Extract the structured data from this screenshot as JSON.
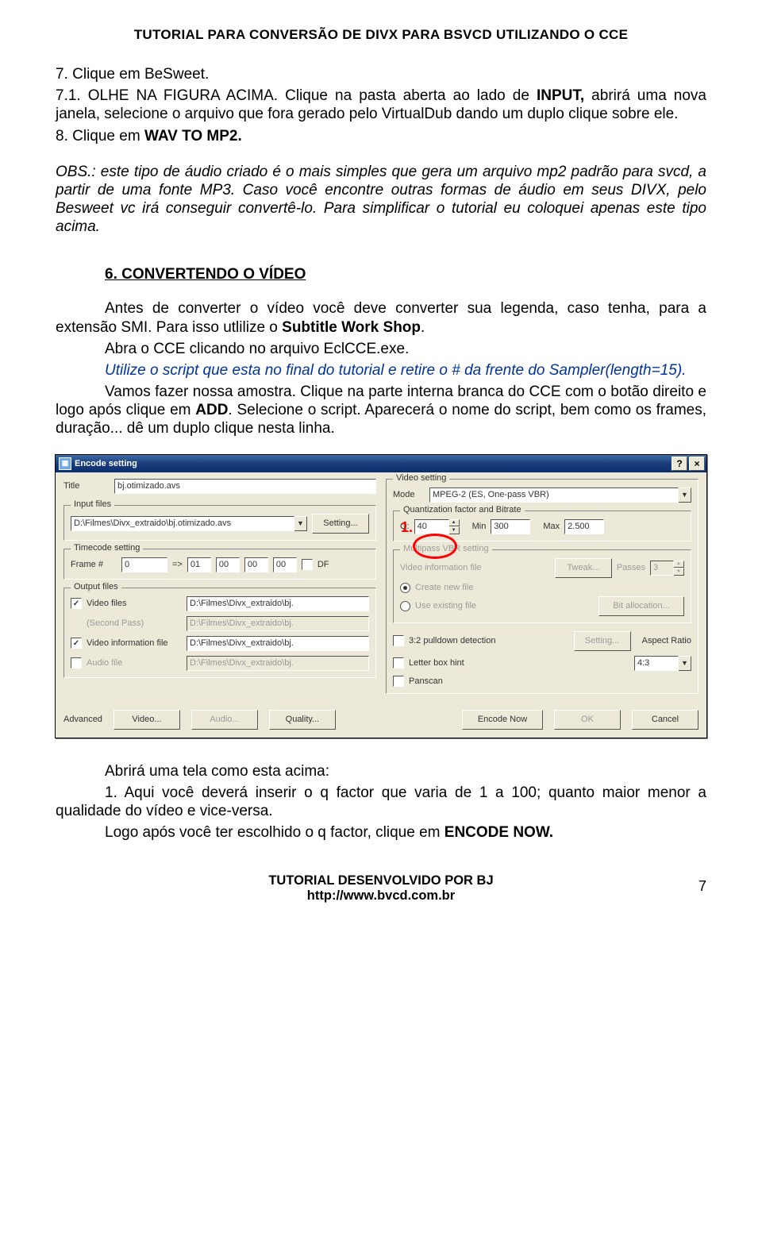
{
  "header": "TUTORIAL PARA CONVERSÃO DE DIVX PARA BSVCD UTILIZANDO O CCE",
  "p7": "7. Clique em BeSweet.",
  "p71a": "7.1. OLHE NA FIGURA ACIMA. Clique na pasta aberta ao lado de ",
  "p71b": "INPUT,",
  "p71c": " abrirá uma nova janela, selecione o arquivo que fora gerado pelo VirtualDub dando um duplo clique sobre ele.",
  "p8a": "8. Clique em ",
  "p8b": "WAV TO MP2.",
  "obs": "OBS.: este tipo de áudio criado é o mais simples que gera um arquivo mp2 padrão para svcd, a partir de uma fonte MP3. Caso você encontre outras formas de áudio em seus DIVX, pelo Besweet vc irá conseguir convertê-lo. Para simplificar o tutorial eu coloquei apenas este tipo acima.",
  "section6": "6. CONVERTENDO O VÍDEO",
  "s6_p1a": "Antes de converter o vídeo você deve converter sua legenda, caso tenha, para a extensão SMI. Para isso utlilize o ",
  "s6_p1b": "Subtitle Work Shop",
  "s6_p1c": ".",
  "s6_p2": "Abra o CCE clicando no arquivo EclCCE.exe.",
  "s6_p3": "Utilize o script que esta no final do tutorial e retire o # da frente do Sampler(length=15).",
  "s6_p4a": "Vamos fazer nossa amostra. Clique na parte interna branca do CCE com o botão direito e logo após clique em ",
  "s6_p4b": "ADD",
  "s6_p4c": ". Selecione o script. Aparecerá o nome do script, bem como os frames, duração... dê um duplo clique nesta linha.",
  "dialog": {
    "title": "Encode setting",
    "help": "?",
    "close": "×",
    "left": {
      "titleLabel": "Title",
      "titleValue": "bj.otimizado.avs",
      "inputGroup": "Input files",
      "inputFile": "D:\\Filmes\\Divx_extraido\\bj.otimizado.avs",
      "settingBtn": "Setting...",
      "timecodeGroup": "Timecode setting",
      "frameLabel": "Frame #",
      "frameValue": "0",
      "arrow": "=>",
      "tc1": "01",
      "tc2": "00",
      "tc3": "00",
      "tc4": "00",
      "dfLabel": "DF",
      "outputGroup": "Output files",
      "videoFiles": "Video files",
      "secondPass": "(Second Pass)",
      "videoInfoFile": "Video information file",
      "audioFile": "Audio file",
      "path1": "D:\\Filmes\\Divx_extraido\\bj.",
      "path2": "D:\\Filmes\\Divx_extraido\\bj.",
      "path3": "D:\\Filmes\\Divx_extraido\\bj.",
      "path4": "D:\\Filmes\\Divx_extraido\\bj."
    },
    "right": {
      "videoSetting": "Video setting",
      "modeLabel": "Mode",
      "modeValue": "MPEG-2 (ES, One-pass VBR)",
      "qGroup": "Quantization factor and Bitrate",
      "qLabel": "Q:",
      "qValue": "40",
      "minLabel": "Min",
      "minValue": "300",
      "maxLabel": "Max",
      "maxValue": "2.500",
      "mpGroup": "Multipass VBR setting",
      "vidInfoFile": "Video information file",
      "tweak": "Tweak...",
      "passesLabel": "Passes",
      "passesValue": "3",
      "createNew": "Create new file",
      "useExisting": "Use existing file",
      "bitAlloc": "Bit allocation...",
      "pd32": "3:2 pulldown detection",
      "pdSetting": "Setting...",
      "aspectLabel": "Aspect Ratio",
      "letterbox": "Letter box hint",
      "aspectValue": "4:3",
      "panscan": "Panscan"
    },
    "bottom": {
      "advanced": "Advanced",
      "video": "Video...",
      "audio": "Audio...",
      "quality": "Quality...",
      "encodeNow": "Encode Now",
      "ok": "OK",
      "cancel": "Cancel"
    }
  },
  "annotation": {
    "num": "1."
  },
  "after1": "Abrirá uma tela como esta acima:",
  "after2a": "1. Aqui você deverá inserir o q factor que varia de 1 a 100; quanto maior menor a qualidade do vídeo e vice-versa.",
  "after3a": "Logo após você ter escolhido o q factor, clique em ",
  "after3b": "ENCODE NOW.",
  "footer1": "TUTORIAL DESENVOLVIDO POR BJ",
  "footer2": "http://www.bvcd.com.br",
  "pageNumber": "7"
}
